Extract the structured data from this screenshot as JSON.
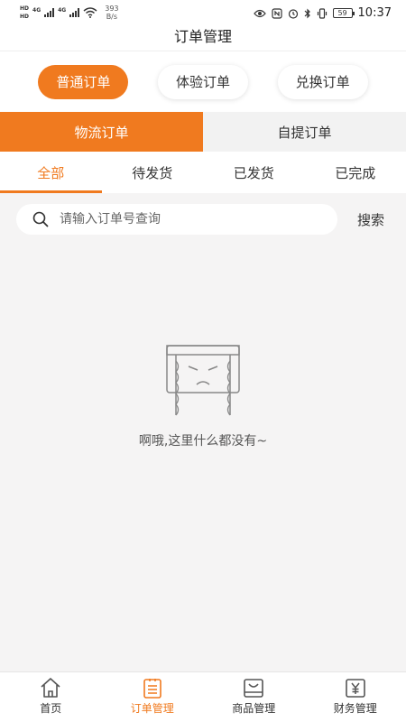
{
  "status_bar": {
    "hd_top": "HD",
    "hd_bottom": "HD",
    "net_1": "4G",
    "net_2": "4G",
    "speed_value": "393",
    "speed_unit": "B/s",
    "battery": "59",
    "time": "10:37"
  },
  "header": {
    "title": "订单管理"
  },
  "order_types": [
    {
      "label": "普通订单",
      "active": true
    },
    {
      "label": "体验订单",
      "active": false
    },
    {
      "label": "兑换订单",
      "active": false
    }
  ],
  "delivery_tabs": [
    {
      "label": "物流订单",
      "active": true
    },
    {
      "label": "自提订单",
      "active": false
    }
  ],
  "status_tabs": [
    {
      "label": "全部",
      "active": true
    },
    {
      "label": "待发货",
      "active": false
    },
    {
      "label": "已发货",
      "active": false
    },
    {
      "label": "已完成",
      "active": false
    }
  ],
  "search": {
    "placeholder": "请输入订单号查询",
    "value": "",
    "button_label": "搜索",
    "icon": "search-icon"
  },
  "empty_state": {
    "icon": "crying-face-icon",
    "message": "啊哦,这里什么都没有~"
  },
  "bottom_nav": [
    {
      "label": "首页",
      "icon": "home-icon",
      "active": false
    },
    {
      "label": "订单管理",
      "icon": "order-list-icon",
      "active": true
    },
    {
      "label": "商品管理",
      "icon": "product-box-icon",
      "active": false
    },
    {
      "label": "财务管理",
      "icon": "finance-yen-icon",
      "active": false
    }
  ],
  "colors": {
    "accent": "#f07a1f",
    "background": "#f5f4f4",
    "inactive_tab": "#f2f2f2"
  }
}
